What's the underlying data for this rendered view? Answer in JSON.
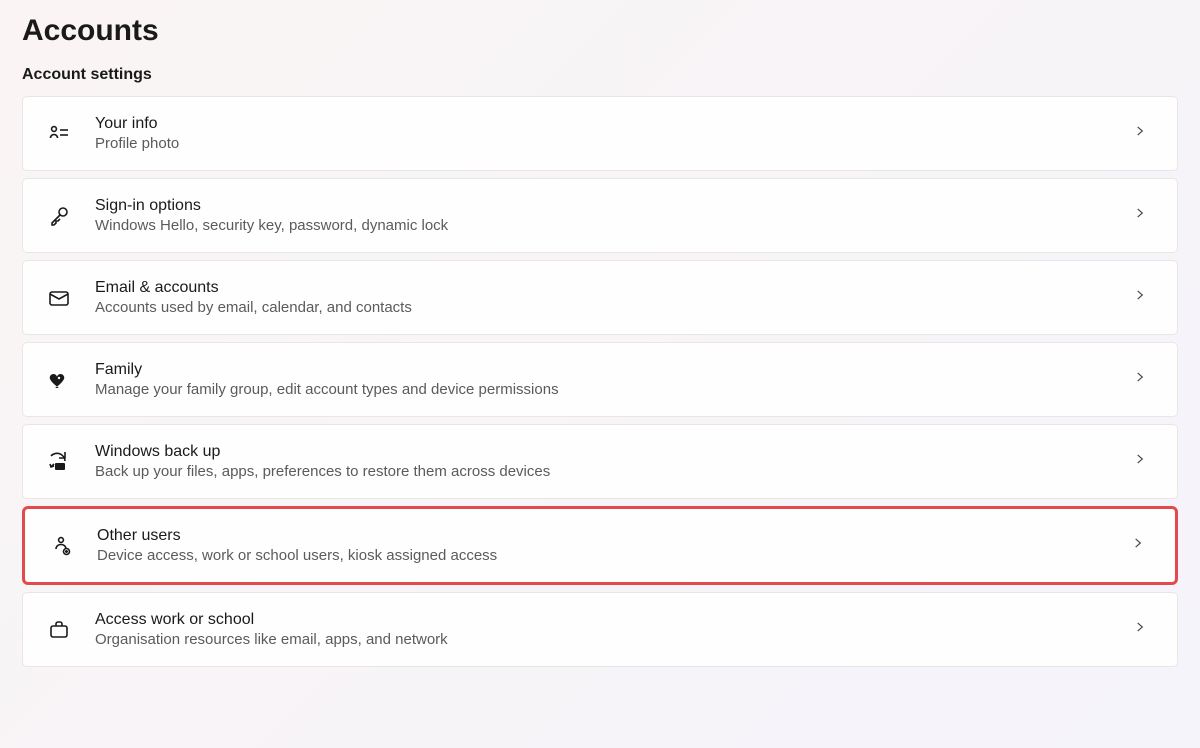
{
  "page": {
    "title": "Accounts",
    "section": "Account settings"
  },
  "items": [
    {
      "title": "Your info",
      "desc": "Profile photo"
    },
    {
      "title": "Sign-in options",
      "desc": "Windows Hello, security key, password, dynamic lock"
    },
    {
      "title": "Email & accounts",
      "desc": "Accounts used by email, calendar, and contacts"
    },
    {
      "title": "Family",
      "desc": "Manage your family group, edit account types and device permissions"
    },
    {
      "title": "Windows back up",
      "desc": "Back up your files, apps, preferences to restore them across devices"
    },
    {
      "title": "Other users",
      "desc": "Device access, work or school users, kiosk assigned access"
    },
    {
      "title": "Access work or school",
      "desc": "Organisation resources like email, apps, and network"
    }
  ]
}
